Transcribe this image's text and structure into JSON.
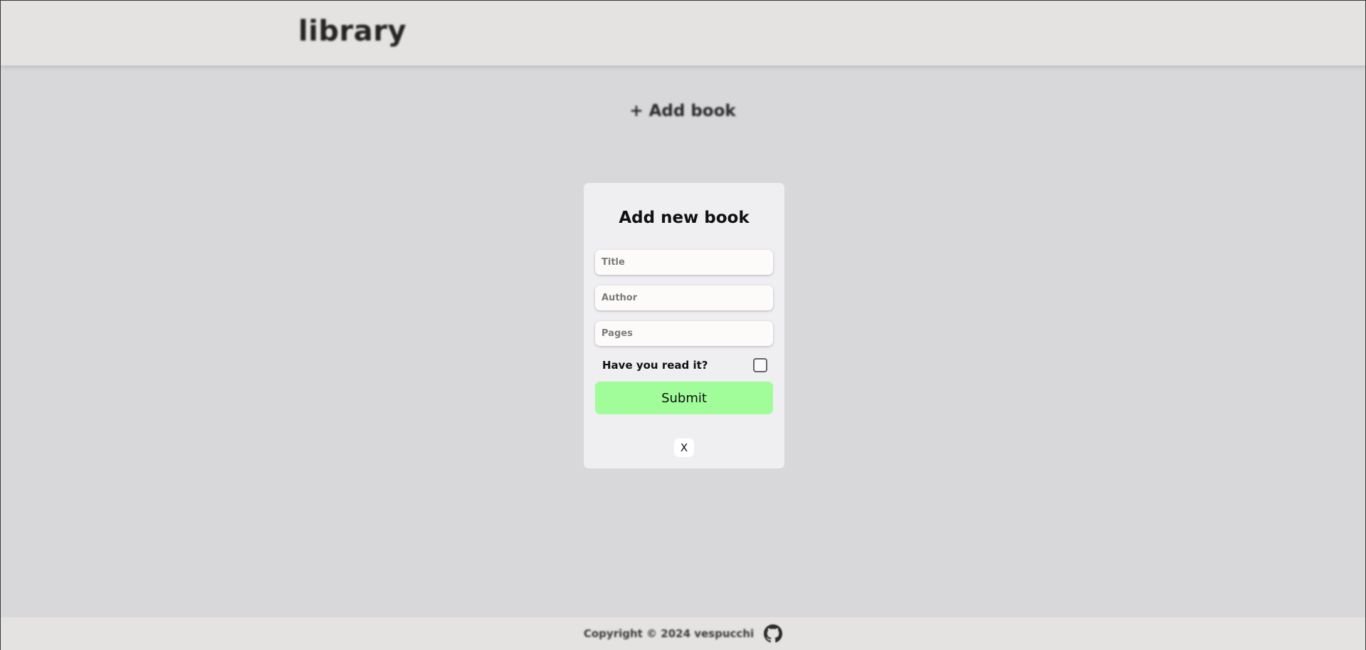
{
  "header": {
    "logo_text": "library"
  },
  "main": {
    "add_book_label": "+ Add book"
  },
  "modal": {
    "title": "Add new book",
    "title_placeholder": "Title",
    "author_placeholder": "Author",
    "pages_placeholder": "Pages",
    "read_label": "Have you read it?",
    "read_checked": false,
    "submit_label": "Submit",
    "close_label": "X"
  },
  "footer": {
    "copyright": "Copyright © 2024 vespucchi",
    "icon": "github-icon"
  },
  "colors": {
    "background": "#d8d7da",
    "header": "#e5e3e1",
    "modal": "#efeef1",
    "submit": "#a1fd9a"
  }
}
